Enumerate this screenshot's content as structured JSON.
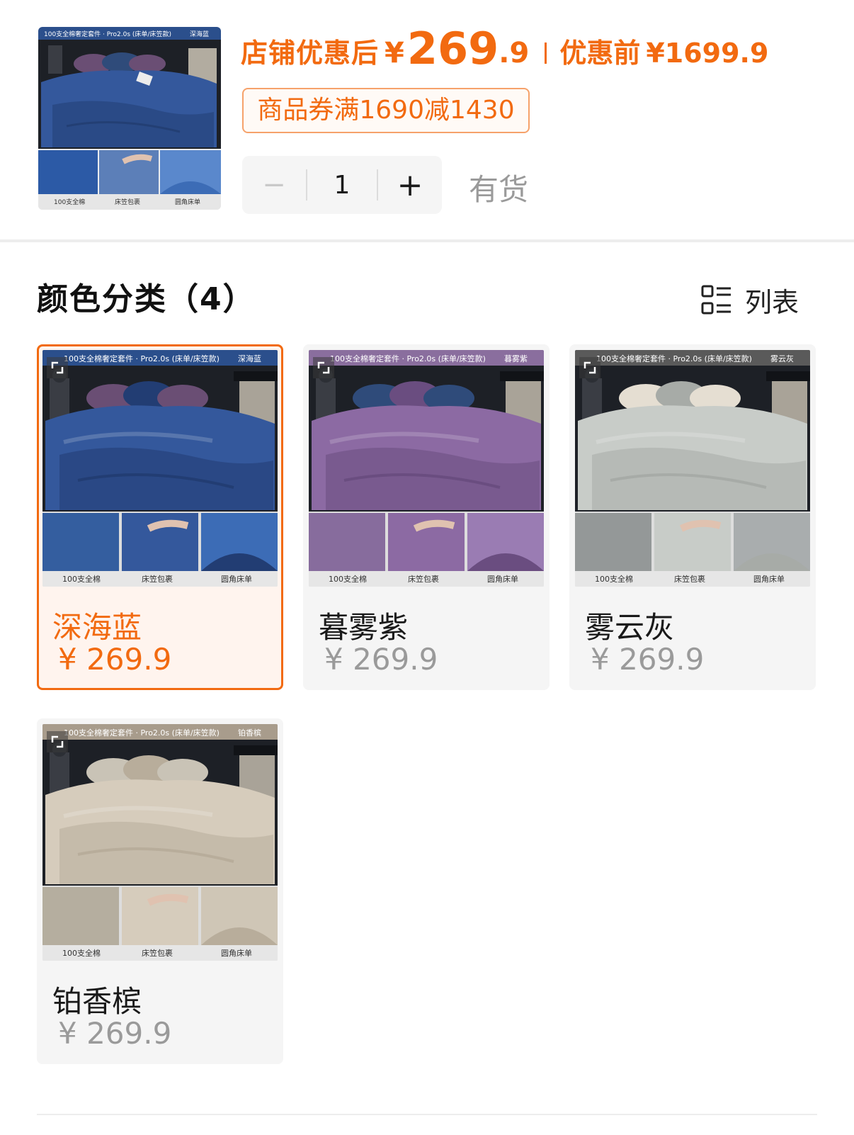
{
  "header": {
    "thumbnail": {
      "banner_left": "100支全棉奢定套件 · Pro2.0s (床单/床笠款)",
      "banner_right": "深海蓝",
      "captions": [
        "100支全棉",
        "床笠包裹",
        "圆角床单"
      ]
    },
    "price_label": "店铺优惠后",
    "currency": "¥",
    "price_int": "269",
    "price_dec": ".9",
    "orig_label": "优惠前",
    "orig_price": "¥1699.9",
    "coupon": "商品券满1690减1430",
    "stepper": {
      "minus": "−",
      "qty": "1",
      "plus": "+"
    },
    "stock": "有货"
  },
  "section": {
    "title": "颜色分类（4）",
    "view_toggle": "列表"
  },
  "variants": [
    {
      "name": "深海蓝",
      "price": "¥ 269.9",
      "banner_left": "100支全棉奢定套件 · Pro2.0s (床单/床笠款)",
      "banner_right": "深海蓝",
      "captions": [
        "100支全棉",
        "床笠包裹",
        "圆角床单"
      ],
      "selected": true,
      "sheet_color": "#34589c",
      "sheet_dark": "#223d73",
      "pillow_color": "#6a4e74",
      "banner_bg": "#2b4f8c",
      "swatch_color": "#3c6cb6"
    },
    {
      "name": "暮雾紫",
      "price": "¥ 269.9",
      "banner_left": "100支全棉奢定套件 · Pro2.0s (床单/床笠款)",
      "banner_right": "暮雾紫",
      "captions": [
        "100支全棉",
        "床笠包裹",
        "圆角床单"
      ],
      "selected": false,
      "sheet_color": "#8c6aa3",
      "sheet_dark": "#6a4d80",
      "pillow_color": "#2f4b7a",
      "banner_bg": "#8a6e9e",
      "swatch_color": "#9a7cb3"
    },
    {
      "name": "雾云灰",
      "price": "¥ 269.9",
      "banner_left": "100支全棉奢定套件 · Pro2.0s (床单/床笠款)",
      "banner_right": "雾云灰",
      "captions": [
        "100支全棉",
        "床笠包裹",
        "圆角床单"
      ],
      "selected": false,
      "sheet_color": "#c8ccc8",
      "sheet_dark": "#a7aba7",
      "pillow_color": "#e5ded2",
      "banner_bg": "#5a5a5a",
      "swatch_color": "#a9adae"
    },
    {
      "name": "铂香槟",
      "price": "¥ 269.9",
      "banner_left": "100支全棉奢定套件 · Pro2.0s (床单/床笠款)",
      "banner_right": "铂香槟",
      "captions": [
        "100支全棉",
        "床笠包裹",
        "圆角床单"
      ],
      "selected": false,
      "sheet_color": "#d6ccbc",
      "sheet_dark": "#b8ad9b",
      "pillow_color": "#c9c3b6",
      "banner_bg": "#a89c8c",
      "swatch_color": "#cfc6b6"
    }
  ],
  "colors": {
    "accent": "#f26a10",
    "muted_text": "#9a9a9a",
    "card_bg": "#f5f5f5"
  }
}
